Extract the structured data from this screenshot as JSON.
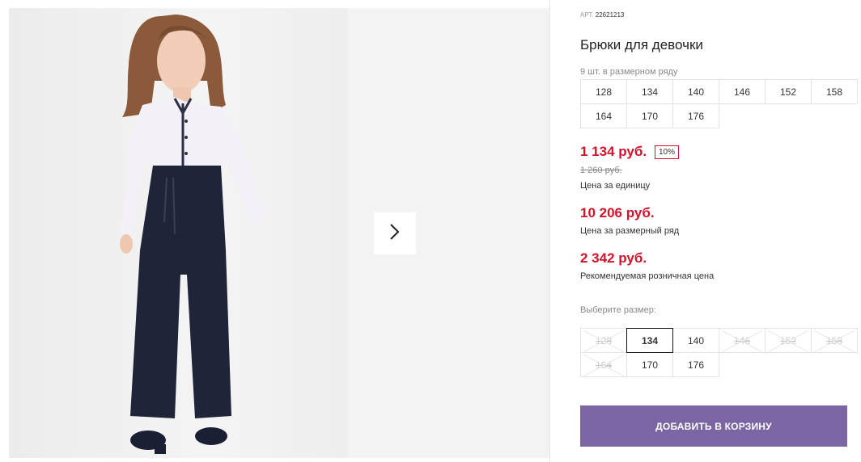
{
  "product": {
    "article_label": "АРТ.",
    "article_number": "22621213",
    "title": "Брюки для девочки",
    "pack_count": "9 шт. в размерном ряду",
    "pack_sizes": [
      "128",
      "134",
      "140",
      "146",
      "152",
      "158",
      "164",
      "170",
      "176"
    ],
    "price_unit": "1 134 руб.",
    "discount": "10%",
    "old_price": "1 260 руб.",
    "price_unit_caption": "Цена за единицу",
    "price_pack": "10 206 руб.",
    "price_pack_caption": "Цена за размерный ряд",
    "price_retail": "2 342 руб.",
    "price_retail_caption": "Рекомендуемая розничная цена",
    "choose_size_label": "Выберите размер:",
    "choose_sizes": [
      {
        "label": "128",
        "available": false
      },
      {
        "label": "134",
        "available": true,
        "selected": true
      },
      {
        "label": "140",
        "available": true
      },
      {
        "label": "146",
        "available": false
      },
      {
        "label": "152",
        "available": false
      },
      {
        "label": "158",
        "available": false
      },
      {
        "label": "164",
        "available": false
      },
      {
        "label": "170",
        "available": true
      },
      {
        "label": "176",
        "available": true
      }
    ],
    "add_to_cart": "ДОБАВИТЬ В КОРЗИНУ"
  },
  "gallery": {
    "next_icon": "chevron-right-icon"
  },
  "colors": {
    "price_red": "#d4122b",
    "button_purple": "#7b65a3"
  }
}
